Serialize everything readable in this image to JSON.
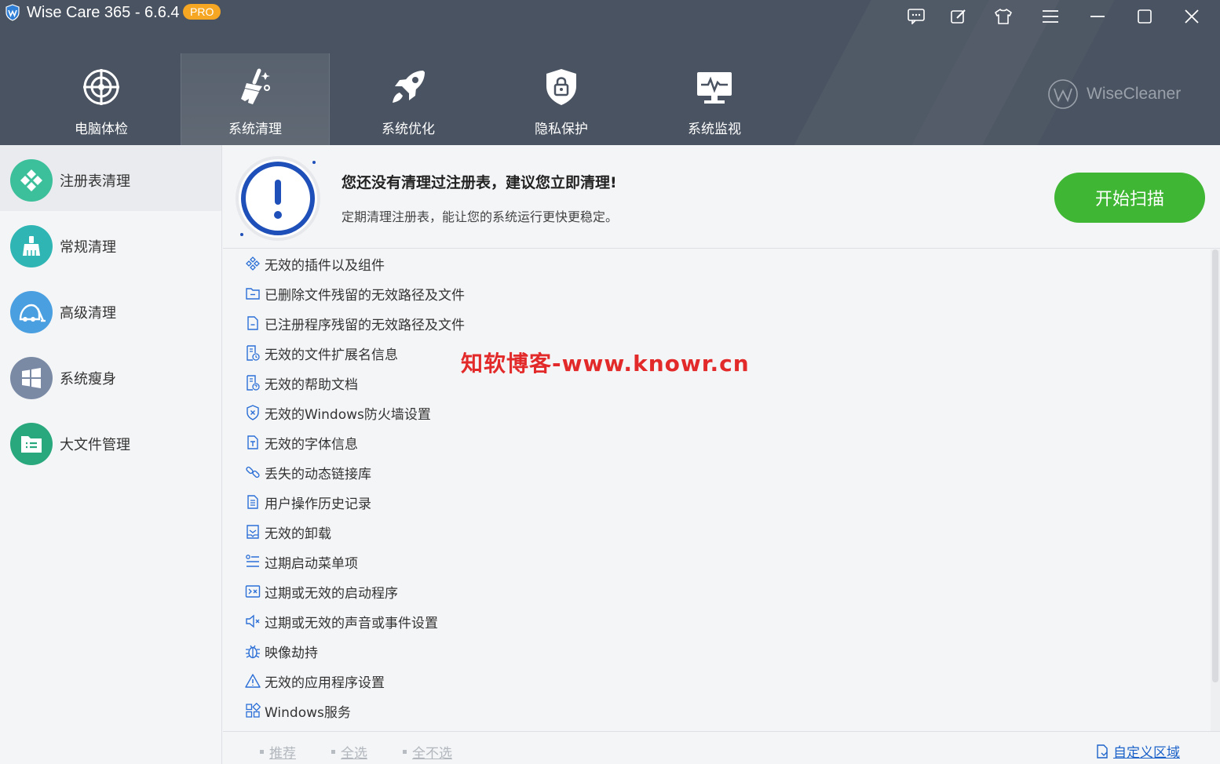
{
  "window": {
    "title": "Wise Care 365 - 6.6.4",
    "badge": "PRO",
    "controls": [
      "feedback-icon",
      "edit-icon",
      "skin-icon",
      "menu-icon",
      "minimize-icon",
      "maximize-icon",
      "close-icon"
    ]
  },
  "nav": {
    "tabs": [
      {
        "label": "电脑体检",
        "icon": "radar-icon"
      },
      {
        "label": "系统清理",
        "icon": "broom-icon",
        "active": true
      },
      {
        "label": "系统优化",
        "icon": "rocket-icon"
      },
      {
        "label": "隐私保护",
        "icon": "shield-lock-icon"
      },
      {
        "label": "系统监视",
        "icon": "monitor-pulse-icon"
      }
    ],
    "brand": "WiseCleaner"
  },
  "sidebar": {
    "items": [
      {
        "label": "注册表清理",
        "icon": "registry-icon",
        "color": "#3cbf9b",
        "active": true
      },
      {
        "label": "常规清理",
        "icon": "broom-icon",
        "color": "#2fb5b3"
      },
      {
        "label": "高级清理",
        "icon": "vacuum-icon",
        "color": "#4a9fe0"
      },
      {
        "label": "系统瘦身",
        "icon": "windows-icon",
        "color": "#7a8aa5"
      },
      {
        "label": "大文件管理",
        "icon": "folder-list-icon",
        "color": "#28a87c"
      }
    ]
  },
  "banner": {
    "title": "您还没有清理过注册表，建议您立即清理!",
    "subtitle": "定期清理注册表，能让您的系统运行更快更稳定。",
    "button": "开始扫描"
  },
  "list": {
    "items": [
      {
        "label": "无效的插件以及组件",
        "icon": "plugin-icon"
      },
      {
        "label": "已删除文件残留的无效路径及文件",
        "icon": "folder-minus-icon"
      },
      {
        "label": "已注册程序残留的无效路径及文件",
        "icon": "file-minus-icon"
      },
      {
        "label": "无效的文件扩展名信息",
        "icon": "file-info-icon"
      },
      {
        "label": "无效的帮助文档",
        "icon": "help-doc-icon"
      },
      {
        "label": "无效的Windows防火墙设置",
        "icon": "firewall-icon"
      },
      {
        "label": "无效的字体信息",
        "icon": "font-icon"
      },
      {
        "label": "丢失的动态链接库",
        "icon": "link-icon"
      },
      {
        "label": "用户操作历史记录",
        "icon": "history-doc-icon"
      },
      {
        "label": "无效的卸载",
        "icon": "uninstall-icon"
      },
      {
        "label": "过期启动菜单项",
        "icon": "start-menu-icon"
      },
      {
        "label": "过期或无效的启动程序",
        "icon": "startup-program-icon"
      },
      {
        "label": "过期或无效的声音或事件设置",
        "icon": "sound-icon"
      },
      {
        "label": "映像劫持",
        "icon": "bug-icon"
      },
      {
        "label": "无效的应用程序设置",
        "icon": "warning-icon"
      },
      {
        "label": "Windows服务",
        "icon": "services-icon"
      }
    ]
  },
  "watermark": "知软博客-www.knowr.cn",
  "footer": {
    "links": [
      "推荐",
      "全选",
      "全不选"
    ],
    "custom": "自定义区域"
  }
}
